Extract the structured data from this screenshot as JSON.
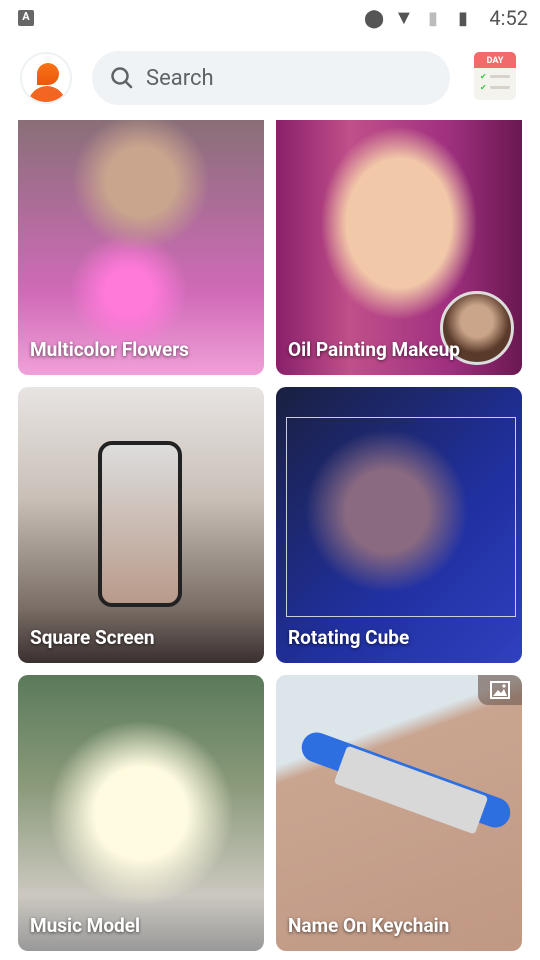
{
  "status_bar": {
    "time": "4:52",
    "icons": [
      "notification-a-icon",
      "location-icon",
      "wifi-icon",
      "no-sim-icon",
      "battery-charging-icon"
    ]
  },
  "header": {
    "search_placeholder": "Search",
    "calendar_label": "DAY"
  },
  "cards": [
    {
      "label": "Multicolor Flowers"
    },
    {
      "label": "Oil Painting Makeup"
    },
    {
      "label": "Square Screen"
    },
    {
      "label": "Rotating Cube"
    },
    {
      "label": "Music Model"
    },
    {
      "label": "Name On Keychain",
      "badge": "image-icon"
    }
  ],
  "colors": {
    "accent": "#f26522",
    "search_bg": "#f0f3f6"
  }
}
